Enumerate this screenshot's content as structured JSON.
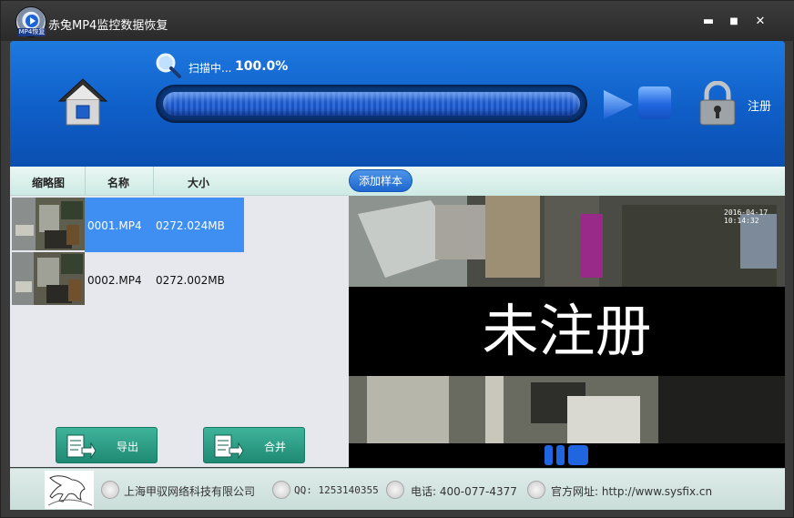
{
  "window": {
    "title": "赤兔MP4监控数据恢复",
    "logo_tag": "MP4恢复",
    "minimize": "▬",
    "maximize": "■",
    "close": "✕"
  },
  "toolbar": {
    "scan_label": "扫描中...",
    "scan_percent": "100.0%",
    "progress": 1.0,
    "register_label": "注册"
  },
  "columns": {
    "thumbnail": "缩略图",
    "name": "名称",
    "size": "大小"
  },
  "preview": {
    "add_sample": "添加样本",
    "watermark": "未注册",
    "camera_timestamp": "2016-04-17 10:14:32"
  },
  "files": [
    {
      "name": "0001.MP4",
      "size": "0272.024MB",
      "selected": true
    },
    {
      "name": "0002.MP4",
      "size": "0272.002MB",
      "selected": false
    }
  ],
  "actions": {
    "export": "导出",
    "merge": "合并"
  },
  "statusbar": {
    "company": "上海甲驭网络科技有限公司",
    "qq": "QQ: 1253140355",
    "phone": "电话: 400-077-4377",
    "website": "官方网址: http://www.sysfix.cn"
  },
  "colors": {
    "toolbar_blue": "#1466d0",
    "selection_blue": "#3f8ef2",
    "button_green": "#2a9e86"
  }
}
